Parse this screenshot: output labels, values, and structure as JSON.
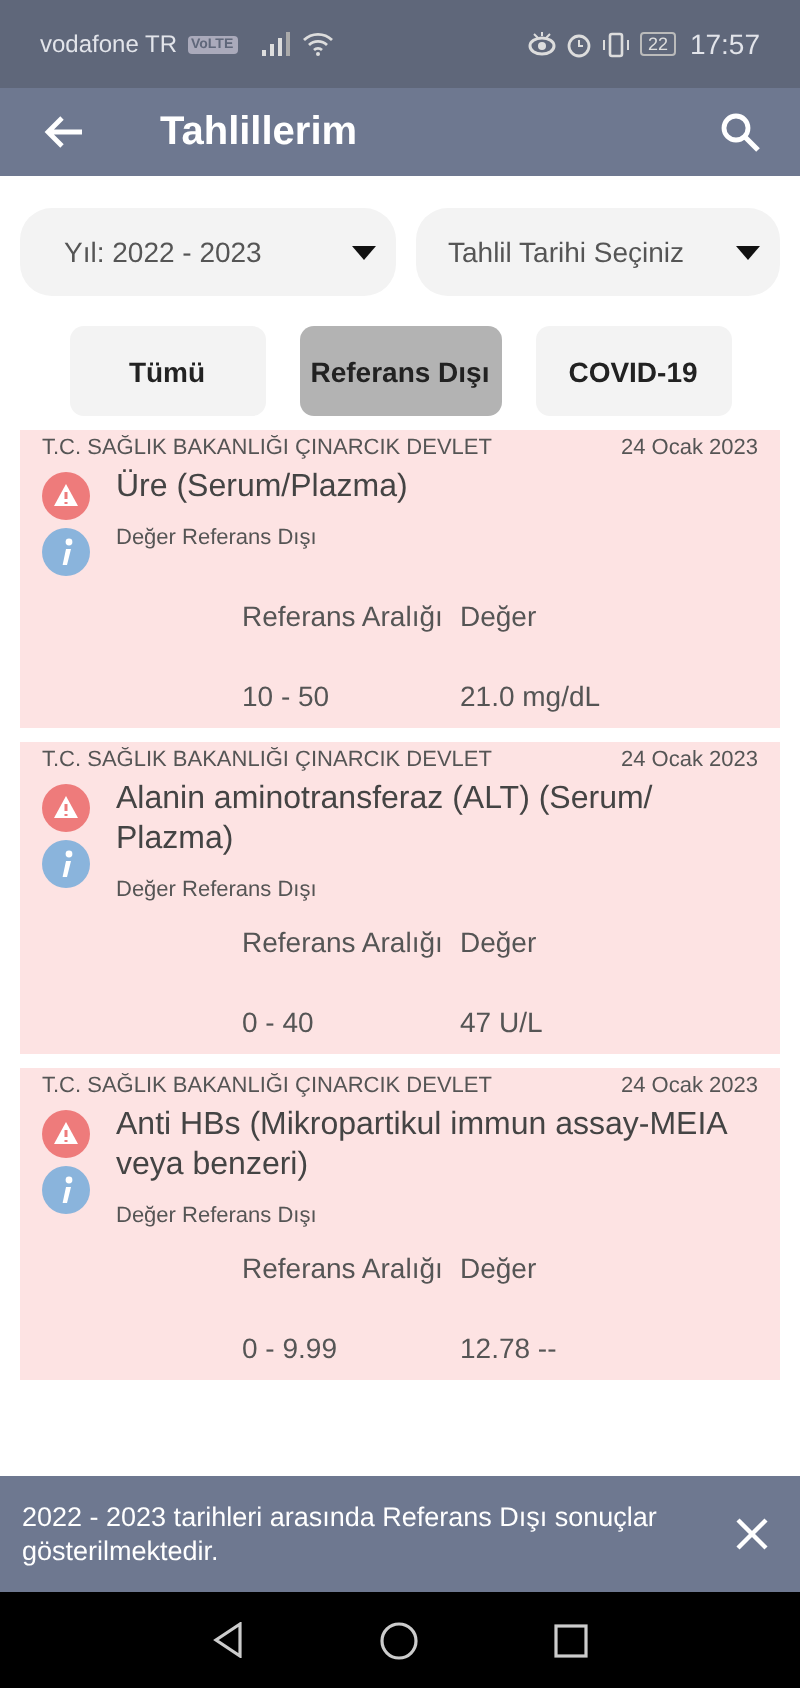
{
  "status_bar": {
    "carrier": "vodafone TR",
    "network_badge": "VoLTE",
    "battery": "22",
    "time": "17:57"
  },
  "app_bar": {
    "title": "Tahlillerim"
  },
  "dropdowns": [
    {
      "value": "Yıl: 2022 - 2023"
    },
    {
      "value": "Tahlil Tarihi Seçiniz"
    }
  ],
  "filters": [
    {
      "label": "Tümü",
      "selected": false
    },
    {
      "label": "Referans Dışı",
      "selected": true
    },
    {
      "label": "COVID-19",
      "selected": false
    }
  ],
  "results": [
    {
      "hospital": "T.C. SAĞLIK BAKANLIĞI ÇINARCIK DEVLET",
      "date": "24 Ocak 2023",
      "test": "Üre (Serum/Plazma)",
      "status": "Değer Referans Dışı",
      "range_label": "Referans Aralığı",
      "value_label": "Değer",
      "range": "10 - 50",
      "value": "21.0 mg/dL"
    },
    {
      "hospital": "T.C. SAĞLIK BAKANLIĞI ÇINARCIK DEVLET",
      "date": "24 Ocak 2023",
      "test": "Alanin aminotransferaz (ALT) (Serum/ Plazma)",
      "status": "Değer Referans Dışı",
      "range_label": "Referans Aralığı",
      "value_label": "Değer",
      "range": "0 - 40",
      "value": "47 U/L"
    },
    {
      "hospital": "T.C. SAĞLIK BAKANLIĞI ÇINARCIK DEVLET",
      "date": "24 Ocak 2023",
      "test": "Anti HBs (Mikropartikul immun assay-MEIA veya benzeri)",
      "status": "Değer Referans Dışı",
      "range_label": "Referans Aralığı",
      "value_label": "Değer",
      "range": "0 - 9.99",
      "value": "12.78 --"
    }
  ],
  "snackbar": {
    "message": "2022 - 2023 tarihleri arasında Referans Dışı sonuçlar gösterilmektedir."
  }
}
